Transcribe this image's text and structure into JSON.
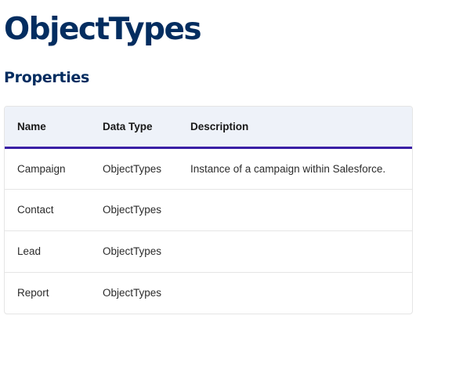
{
  "page": {
    "title": "ObjectTypes",
    "section_title": "Properties"
  },
  "table": {
    "headers": {
      "name": "Name",
      "data_type": "Data Type",
      "description": "Description"
    },
    "rows": [
      {
        "name": "Campaign",
        "data_type": "ObjectTypes",
        "description": "Instance of a campaign within Salesforce."
      },
      {
        "name": "Contact",
        "data_type": "ObjectTypes",
        "description": ""
      },
      {
        "name": "Lead",
        "data_type": "ObjectTypes",
        "description": ""
      },
      {
        "name": "Report",
        "data_type": "ObjectTypes",
        "description": ""
      }
    ]
  },
  "colors": {
    "heading": "#032d60",
    "header_bg": "#eef2f9",
    "header_underline": "#3a1fa6",
    "border": "#e5e5e5",
    "text": "#2b2b2b"
  }
}
